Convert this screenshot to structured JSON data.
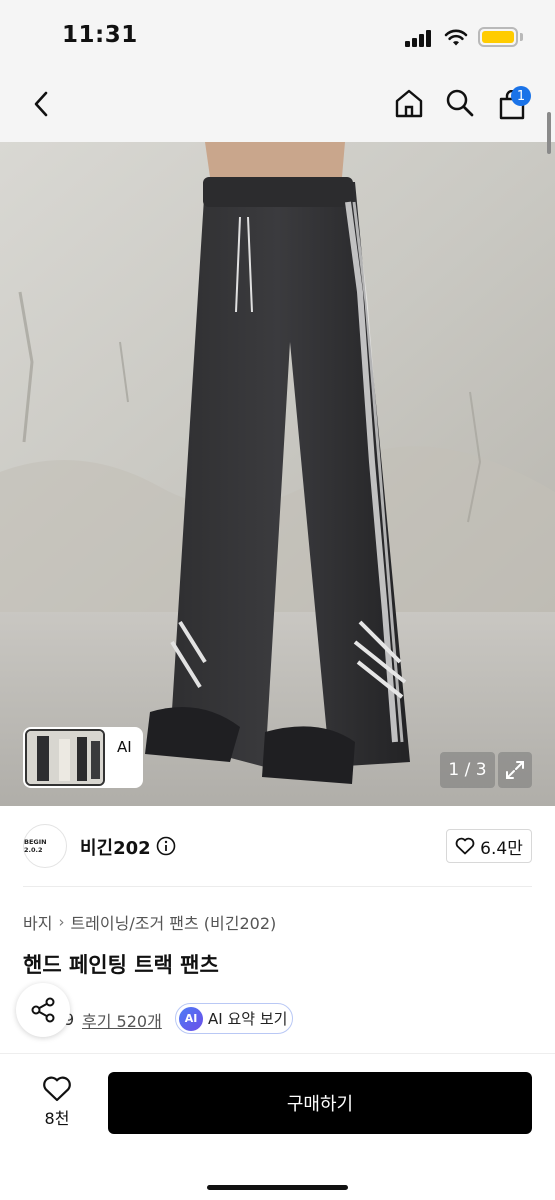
{
  "status_bar": {
    "time": "11:31"
  },
  "header": {
    "cart_count": "1"
  },
  "gallery": {
    "counter": "1 / 3",
    "thumbnail_ai_label": "AI"
  },
  "brand": {
    "logo_text": "BEGIN 2.0.2",
    "name": "비긴202",
    "likes": "6.4만"
  },
  "breadcrumb": [
    "바지",
    "트레이닝/조거 팬츠 (비긴202)"
  ],
  "product": {
    "title": "핸드 페인팅 트랙 팬츠",
    "rating_partial": "9",
    "reviews": "후기 520개",
    "ai_badge": "AI",
    "ai_summary": "AI 요약 보기"
  },
  "bottom_bar": {
    "wish_count": "8천",
    "buy_label": "구매하기"
  },
  "colors": {
    "accent_blue": "#1a73e8",
    "buy_button": "#000000",
    "battery": "#ffcc00"
  },
  "icons": [
    "back-icon",
    "home-icon",
    "search-icon",
    "cart-icon",
    "chevron-right-icon",
    "expand-icon",
    "info-icon",
    "heart-icon",
    "share-icon"
  ]
}
